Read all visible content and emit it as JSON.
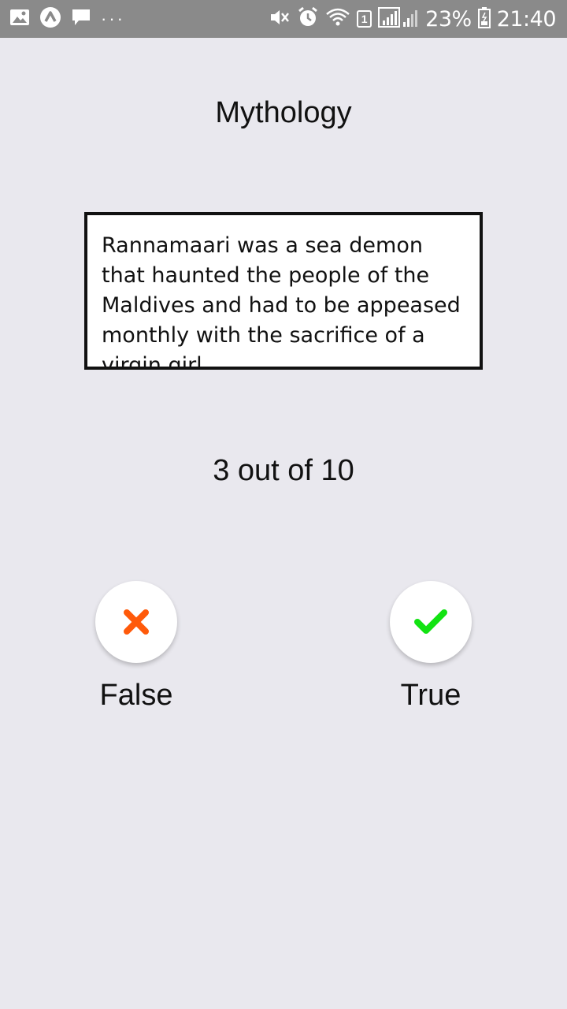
{
  "status_bar": {
    "battery": "23%",
    "time": "21:40",
    "sim_slot": "1",
    "icons": [
      "image-icon",
      "app-icon",
      "message-icon",
      "more-dots-icon",
      "mute-icon",
      "alarm-icon",
      "wifi-icon",
      "signal-icon",
      "battery-icon"
    ]
  },
  "quiz": {
    "category": "Mythology",
    "question": "Rannamaari was a sea demon that haunted the people of the Maldives and had to be appeased monthly with the sacrifice of a virgin girl.",
    "progress": "3 out of 10"
  },
  "answers": {
    "false_label": "False",
    "true_label": "True"
  },
  "colors": {
    "false_icon": "#ff5a0a",
    "true_icon": "#12e312",
    "background": "#e9e8ee",
    "status_bar": "#8a8a8a"
  }
}
